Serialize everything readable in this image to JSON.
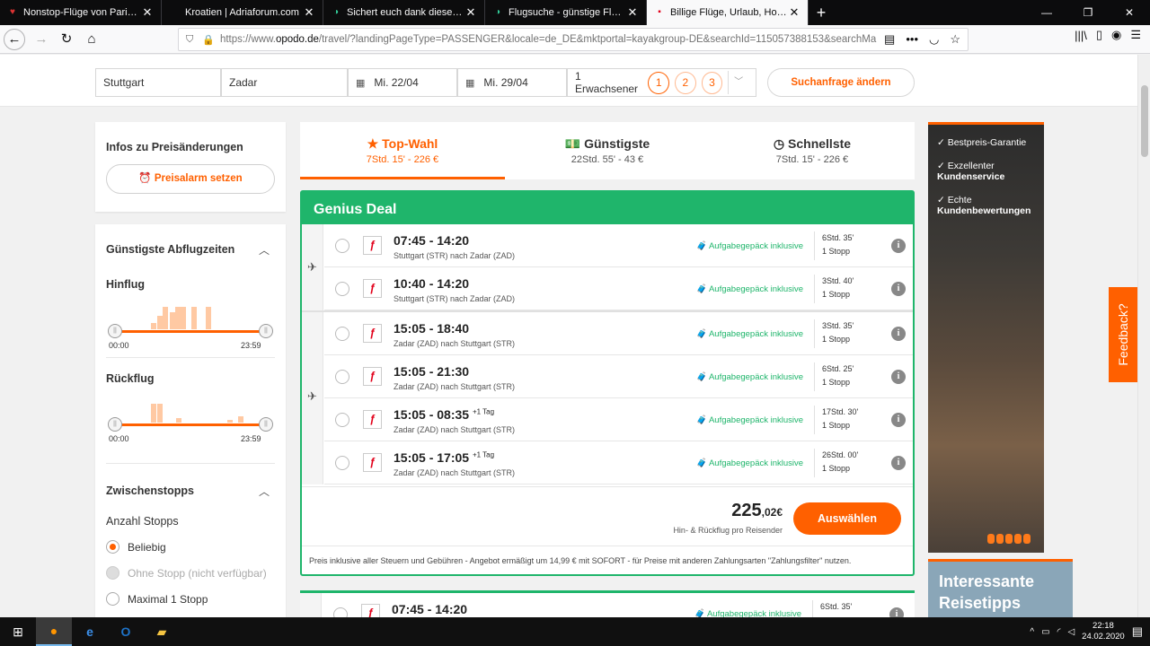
{
  "browser": {
    "tabs": [
      {
        "title": "Nonstop-Flüge von Paris nach",
        "fav_color": "#d33",
        "fav": "♥"
      },
      {
        "title": "Kroatien | Adriaforum.com",
        "fav_color": "#555",
        "fav": ""
      },
      {
        "title": "Sichert euch dank dieses Ryana",
        "fav_color": "#3c9",
        "fav": "◑"
      },
      {
        "title": "Flugsuche - günstige Flüge suc",
        "fav_color": "#3c9",
        "fav": "◑"
      },
      {
        "title": "Billige Flüge, Urlaub, Hotels un",
        "fav_color": "#e2001a",
        "fav": "▪"
      }
    ],
    "url_prefix": "https://www.",
    "url_domain": "opodo.de",
    "url_rest": "/travel/?landingPageType=PASSENGER&locale=de_DE&mktportal=kayakgroup-DE&searchId=115057388153&searchMa"
  },
  "search": {
    "from": "Stuttgart",
    "to": "Zadar",
    "depart": "Mi. 22/04",
    "return": "Mi. 29/04",
    "passengers": "1 Erwachsener",
    "pax_options": [
      "1",
      "2",
      "3"
    ],
    "modify_label": "Suchanfrage ändern"
  },
  "sidebar": {
    "price_info_title": "Infos zu Preisänderungen",
    "price_alarm_label": "Preisalarm setzen",
    "departure_times_title": "Günstigste Abflugzeiten",
    "outbound_label": "Hinflug",
    "inbound_label": "Rückflug",
    "time_start": "00:00",
    "time_end": "23:59",
    "stops_title": "Zwischenstopps",
    "stops_count_label": "Anzahl Stopps",
    "stop_options": [
      {
        "label": "Beliebig",
        "selected": true,
        "disabled": false
      },
      {
        "label": "Ohne Stopp (nicht verfügbar)",
        "selected": false,
        "disabled": true
      },
      {
        "label": "Maximal 1 Stopp",
        "selected": false,
        "disabled": false
      }
    ]
  },
  "sort_tabs": [
    {
      "icon": "★",
      "label": "Top-Wahl",
      "sub": "7Std. 15' - 226 €",
      "active": true
    },
    {
      "icon": "💵",
      "label": "Günstigste",
      "sub": "22Std. 55' - 43 €",
      "active": false
    },
    {
      "icon": "◷",
      "label": "Schnellste",
      "sub": "7Std. 15' - 226 €",
      "active": false
    }
  ],
  "deal": {
    "title": "Genius Deal",
    "baggage_label": "Aufgabegepäck inklusive",
    "outbound": [
      {
        "time": "07:45 - 14:20",
        "plus": "",
        "route": "Stuttgart (STR) nach Zadar (ZAD)",
        "duration": "6Std. 35'",
        "stops": "1 Stopp"
      },
      {
        "time": "10:40 - 14:20",
        "plus": "",
        "route": "Stuttgart (STR) nach Zadar (ZAD)",
        "duration": "3Std. 40'",
        "stops": "1 Stopp"
      }
    ],
    "inbound": [
      {
        "time": "15:05 - 18:40",
        "plus": "",
        "route": "Zadar (ZAD) nach Stuttgart (STR)",
        "duration": "3Std. 35'",
        "stops": "1 Stopp"
      },
      {
        "time": "15:05 - 21:30",
        "plus": "",
        "route": "Zadar (ZAD) nach Stuttgart (STR)",
        "duration": "6Std. 25'",
        "stops": "1 Stopp"
      },
      {
        "time": "15:05 - 08:35",
        "plus": "+1 Tag",
        "route": "Zadar (ZAD) nach Stuttgart (STR)",
        "duration": "17Std. 30'",
        "stops": "1 Stopp"
      },
      {
        "time": "15:05 - 17:05",
        "plus": "+1 Tag",
        "route": "Zadar (ZAD) nach Stuttgart (STR)",
        "duration": "26Std. 00'",
        "stops": "1 Stopp"
      }
    ],
    "price_main": "225",
    "price_cents": ",02€",
    "price_sub": "Hin- & Rückflug pro Reisender",
    "select_label": "Auswählen",
    "footer": "Preis inklusive aller Steuern und Gebühren - Angebot ermäßigt um 14,99 € mit SOFORT - für Preise mit anderen Zahlungsarten \"Zahlungsfilter\" nutzen."
  },
  "next_deal": {
    "time": "07:45 - 14:20",
    "baggage": "Aufgabegepäck inklusive",
    "duration": "6Std. 35'"
  },
  "ad": {
    "items": [
      {
        "a": "Bestpreis-Garantie",
        "b": ""
      },
      {
        "a": "Exzellenter",
        "b": "Kundenservice"
      },
      {
        "a": "Echte",
        "b": "Kundenbewertungen"
      }
    ],
    "banner2": "Interessante Reisetipps"
  },
  "feedback_label": "Feedback?",
  "taskbar": {
    "time": "22:18",
    "date": "24.02.2020"
  },
  "colors": {
    "accent": "#ff6000",
    "genius_green": "#1fb56b"
  }
}
